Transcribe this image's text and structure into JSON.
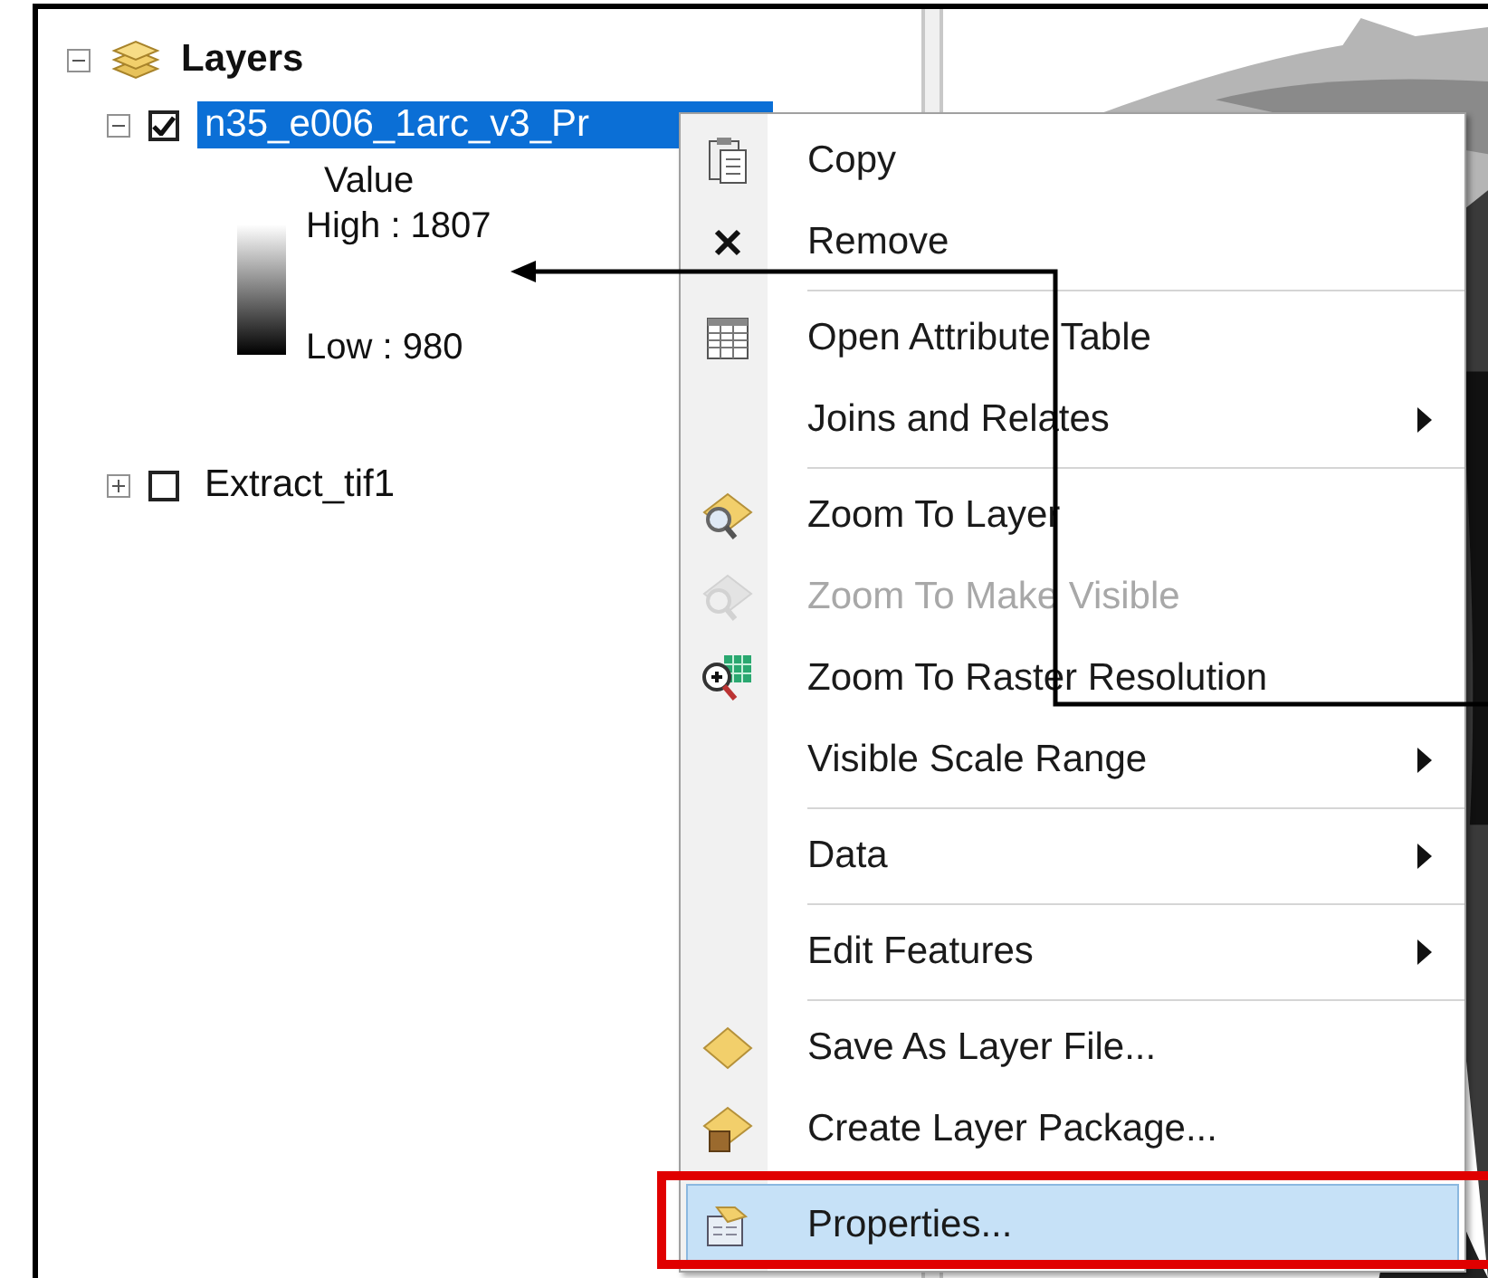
{
  "toc": {
    "root": {
      "label": "Layers",
      "expanded": true,
      "children": [
        {
          "label": "n35_e006_1arc_v3_Pr",
          "checked": true,
          "selected": true,
          "expanded": true,
          "legend": {
            "heading": "Value",
            "high": "High : 1807",
            "low": "Low : 980"
          }
        },
        {
          "label": "Extract_tif1",
          "checked": false,
          "selected": false,
          "expanded": false
        }
      ]
    }
  },
  "context_menu": {
    "items": [
      {
        "kind": "item",
        "label": "Copy",
        "disabled": false,
        "submenu": false,
        "selected": false
      },
      {
        "kind": "item",
        "label": "Remove",
        "disabled": false,
        "submenu": false,
        "selected": false
      },
      {
        "kind": "separator"
      },
      {
        "kind": "item",
        "label": "Open Attribute Table",
        "disabled": false,
        "submenu": false,
        "selected": false
      },
      {
        "kind": "item",
        "label": "Joins and Relates",
        "disabled": false,
        "submenu": true,
        "selected": false
      },
      {
        "kind": "separator"
      },
      {
        "kind": "item",
        "label": "Zoom To Layer",
        "disabled": false,
        "submenu": false,
        "selected": false
      },
      {
        "kind": "item",
        "label": "Zoom To Make Visible",
        "disabled": true,
        "submenu": false,
        "selected": false
      },
      {
        "kind": "item",
        "label": "Zoom To Raster Resolution",
        "disabled": false,
        "submenu": false,
        "selected": false
      },
      {
        "kind": "item",
        "label": "Visible Scale Range",
        "disabled": false,
        "submenu": true,
        "selected": false
      },
      {
        "kind": "separator"
      },
      {
        "kind": "item",
        "label": "Data",
        "disabled": false,
        "submenu": true,
        "selected": false
      },
      {
        "kind": "separator"
      },
      {
        "kind": "item",
        "label": "Edit Features",
        "disabled": false,
        "submenu": true,
        "selected": false
      },
      {
        "kind": "separator"
      },
      {
        "kind": "item",
        "label": "Save As Layer File...",
        "disabled": false,
        "submenu": false,
        "selected": false
      },
      {
        "kind": "item",
        "label": "Create Layer Package...",
        "disabled": false,
        "submenu": false,
        "selected": false
      },
      {
        "kind": "separator"
      },
      {
        "kind": "item",
        "label": "Properties...",
        "disabled": false,
        "submenu": false,
        "selected": true
      }
    ]
  }
}
